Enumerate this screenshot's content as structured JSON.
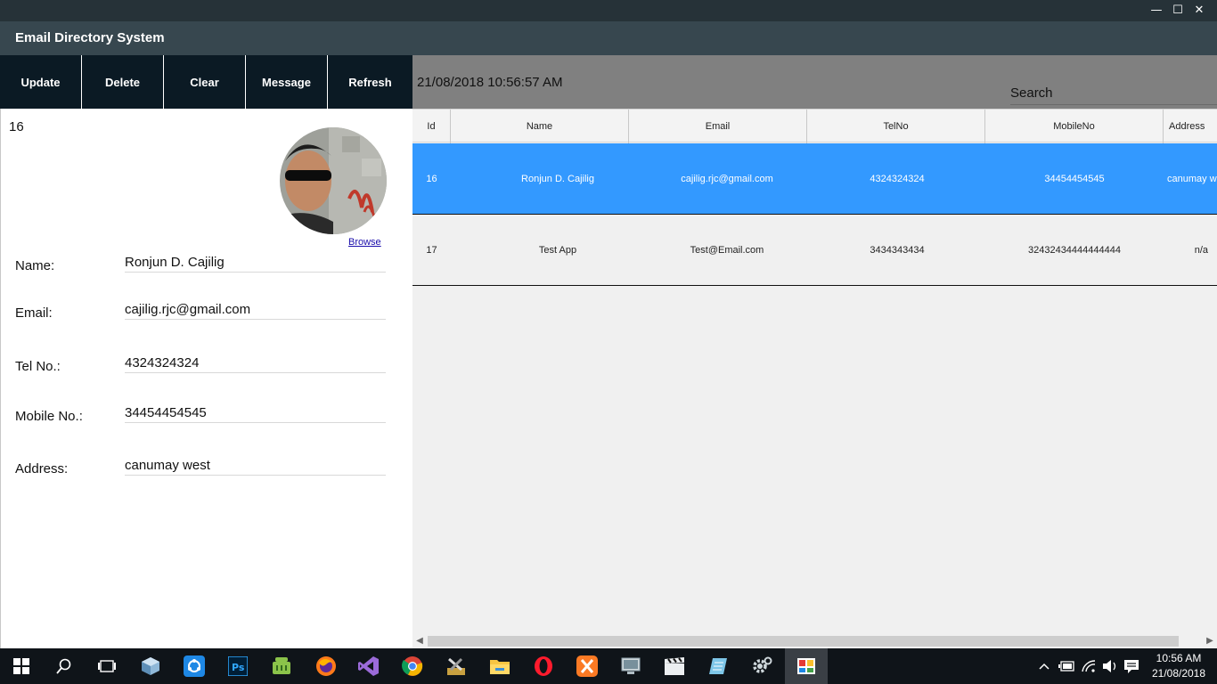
{
  "window": {
    "title": "Email Directory System",
    "controls": [
      "minimize-icon",
      "maximize-icon",
      "close-icon"
    ]
  },
  "toolbar": {
    "buttons": [
      "Update",
      "Delete",
      "Clear",
      "Message",
      "Refresh"
    ]
  },
  "detail": {
    "id": "16",
    "browse_label": "Browse",
    "fields": {
      "name_label": "Name:",
      "name_value": "Ronjun D. Cajilig",
      "email_label": "Email:",
      "email_value": "cajilig.rjc@gmail.com",
      "tel_label": "Tel No.:",
      "tel_value": "4324324324",
      "mobile_label": "Mobile No.:",
      "mobile_value": "34454454545",
      "address_label": "Address:",
      "address_value": "canumay west"
    }
  },
  "header_bar": {
    "datetime": "21/08/2018 10:56:57 AM",
    "search_label": "Search"
  },
  "grid": {
    "columns": [
      "Id",
      "Name",
      "Email",
      "TelNo",
      "MobileNo",
      "Address"
    ],
    "rows": [
      {
        "id": "16",
        "name": "Ronjun D. Cajilig",
        "email": "cajilig.rjc@gmail.com",
        "tel": "4324324324",
        "mobile": "34454454545",
        "address": "canumay w"
      },
      {
        "id": "17",
        "name": "Test App",
        "email": "Test@Email.com",
        "tel": "3434343434",
        "mobile": "32432434444444444",
        "address": "n/a"
      }
    ],
    "selected_row_color": "#3399ff"
  },
  "taskbar": {
    "time": "10:56 AM",
    "date": "21/08/2018",
    "icons": [
      "windows-start-icon",
      "search-icon",
      "task-view-icon",
      "virtualbox-icon",
      "sync-icon",
      "photoshop-icon",
      "android-icon",
      "firefox-icon",
      "visual-studio-icon",
      "chrome-icon",
      "tools-icon",
      "file-explorer-icon",
      "opera-icon",
      "xampp-icon",
      "monitor-icon",
      "video-clapper-icon",
      "notepad-icon",
      "settings-gear-icon",
      "active-app-icon"
    ]
  }
}
